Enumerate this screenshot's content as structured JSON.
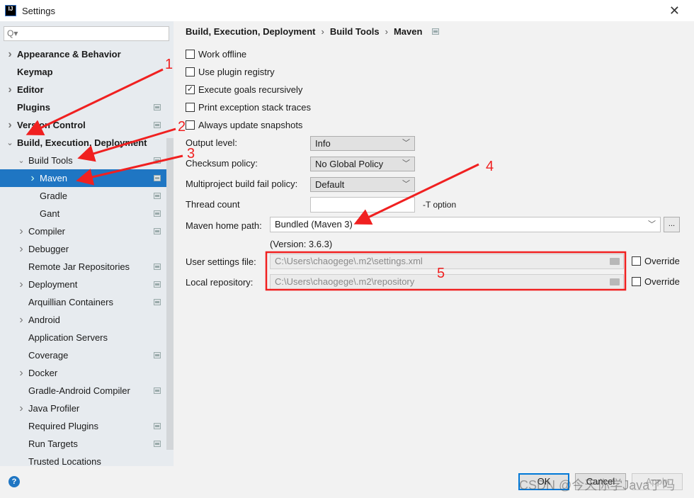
{
  "window": {
    "title": "Settings",
    "logo": "IJ"
  },
  "sidebar": {
    "search_placeholder": "Q▾",
    "items": [
      {
        "label": "Appearance & Behavior",
        "expander": "collapsed",
        "bold": true,
        "level": 0
      },
      {
        "label": "Keymap",
        "bold": true,
        "level": 0
      },
      {
        "label": "Editor",
        "expander": "collapsed",
        "bold": true,
        "level": 0
      },
      {
        "label": "Plugins",
        "bold": true,
        "level": 0,
        "page_icon": true
      },
      {
        "label": "Version Control",
        "expander": "collapsed",
        "bold": true,
        "level": 0,
        "page_icon": true
      },
      {
        "label": "Build, Execution, Deployment",
        "expander": "expanded",
        "bold": true,
        "level": 0
      },
      {
        "label": "Build Tools",
        "expander": "expanded",
        "level": 1,
        "page_icon": true
      },
      {
        "label": "Maven",
        "expander": "collapsed",
        "level": 2,
        "page_icon": true,
        "selected": true
      },
      {
        "label": "Gradle",
        "level": 2,
        "page_icon": true
      },
      {
        "label": "Gant",
        "level": 2,
        "page_icon": true
      },
      {
        "label": "Compiler",
        "expander": "collapsed",
        "level": 1,
        "page_icon": true
      },
      {
        "label": "Debugger",
        "expander": "collapsed",
        "level": 1
      },
      {
        "label": "Remote Jar Repositories",
        "level": 1,
        "page_icon": true
      },
      {
        "label": "Deployment",
        "expander": "collapsed",
        "level": 1,
        "page_icon": true
      },
      {
        "label": "Arquillian Containers",
        "level": 1,
        "page_icon": true
      },
      {
        "label": "Android",
        "expander": "collapsed",
        "level": 1
      },
      {
        "label": "Application Servers",
        "level": 1
      },
      {
        "label": "Coverage",
        "level": 1,
        "page_icon": true
      },
      {
        "label": "Docker",
        "expander": "collapsed",
        "level": 1
      },
      {
        "label": "Gradle-Android Compiler",
        "level": 1,
        "page_icon": true
      },
      {
        "label": "Java Profiler",
        "expander": "collapsed",
        "level": 1
      },
      {
        "label": "Required Plugins",
        "level": 1,
        "page_icon": true
      },
      {
        "label": "Run Targets",
        "level": 1,
        "page_icon": true
      },
      {
        "label": "Trusted Locations",
        "level": 1
      }
    ]
  },
  "breadcrumb": [
    "Build, Execution, Deployment",
    "Build Tools",
    "Maven"
  ],
  "checkboxes": [
    {
      "label": "Work offline",
      "checked": false
    },
    {
      "label": "Use plugin registry",
      "checked": false
    },
    {
      "label": "Execute goals recursively",
      "checked": true
    },
    {
      "label": "Print exception stack traces",
      "checked": false
    },
    {
      "label": "Always update snapshots",
      "checked": false
    }
  ],
  "form": {
    "output_level": {
      "label": "Output level:",
      "value": "Info"
    },
    "checksum_policy": {
      "label": "Checksum policy:",
      "value": "No Global Policy"
    },
    "fail_policy": {
      "label": "Multiproject build fail policy:",
      "value": "Default"
    },
    "thread_count": {
      "label": "Thread count",
      "value": "",
      "suffix": "-T option"
    },
    "maven_home": {
      "label": "Maven home path:",
      "value": "Bundled (Maven 3)",
      "browse": "...",
      "version": "(Version: 3.6.3)"
    },
    "user_settings": {
      "label": "User settings file:",
      "value": "C:\\Users\\chaogege\\.m2\\settings.xml",
      "override": "Override",
      "override_checked": false
    },
    "local_repo": {
      "label": "Local repository:",
      "value": "C:\\Users\\chaogege\\.m2\\repository",
      "override": "Override",
      "override_checked": false
    }
  },
  "buttons": {
    "help": "?",
    "ok": "OK",
    "cancel": "Cancel",
    "apply": "Apply"
  },
  "watermark": "CSDN @今天你学Java了吗",
  "annotations": {
    "color": "#f02020",
    "labels": [
      "1",
      "2",
      "3",
      "4",
      "5"
    ]
  },
  "colors": {
    "accent": "#1f76c3",
    "sidebar_bg": "#e7ebef",
    "panel_bg": "#f2f2f2"
  }
}
